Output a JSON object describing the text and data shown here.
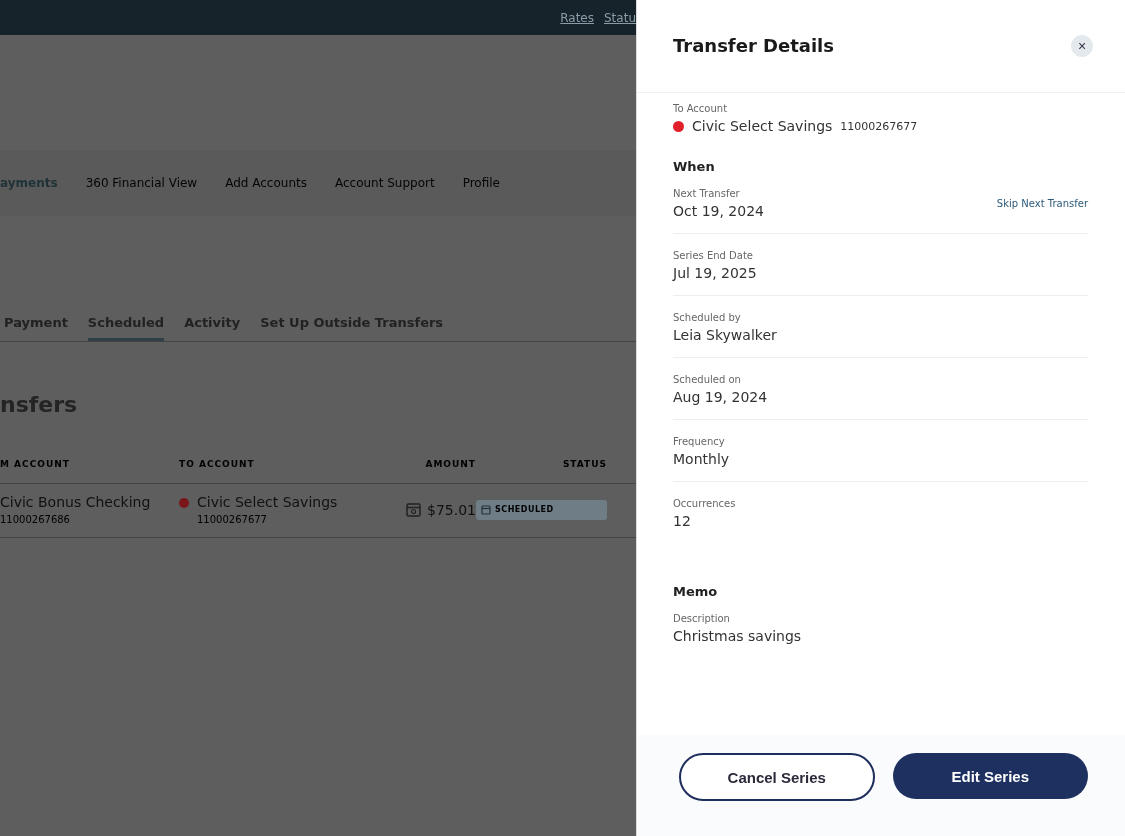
{
  "top_bar": {
    "links": [
      "Rates",
      "Statu"
    ]
  },
  "nav": {
    "items": [
      {
        "label": "ayments",
        "selected": true
      },
      {
        "label": "360 Financial View",
        "selected": false
      },
      {
        "label": "Add Accounts",
        "selected": false
      },
      {
        "label": "Account Support",
        "selected": false
      },
      {
        "label": "Profile",
        "selected": false
      }
    ]
  },
  "tabs": [
    {
      "label": "Payment",
      "selected": false
    },
    {
      "label": "Scheduled",
      "selected": true
    },
    {
      "label": "Activity",
      "selected": false
    },
    {
      "label": "Set Up Outside Transfers",
      "selected": false
    }
  ],
  "page_heading": "nsfers",
  "table": {
    "columns": [
      "M ACCOUNT",
      "TO ACCOUNT",
      "AMOUNT",
      "STATUS"
    ],
    "rows": [
      {
        "from_account": {
          "name": "Civic Bonus Checking",
          "number": "11000267686"
        },
        "to_account": {
          "name": "Civic Select Savings",
          "number": "11000267677",
          "color": "#7a1519"
        },
        "amount": "$75.01",
        "status": "SCHEDULED"
      }
    ]
  },
  "panel": {
    "title": "Transfer Details",
    "close": "×",
    "to_account": {
      "label": "To Account",
      "name": "Civic Select Savings",
      "number": "11000267677",
      "color": "#e0202a"
    },
    "sections": [
      {
        "heading": "When",
        "fields": [
          {
            "label": "Next Transfer",
            "value": "Oct 19, 2024",
            "action": "Skip Next Transfer"
          },
          {
            "label": "Series End Date",
            "value": "Jul 19, 2025"
          },
          {
            "label": "Scheduled by",
            "value": "Leia Skywalker"
          },
          {
            "label": "Scheduled on",
            "value": "Aug 19, 2024"
          },
          {
            "label": "Frequency",
            "value": "Monthly"
          },
          {
            "label": "Occurrences",
            "value": "12"
          }
        ]
      },
      {
        "heading": "Memo",
        "fields": [
          {
            "label": "Description",
            "value": "Christmas savings"
          }
        ]
      }
    ],
    "buttons": [
      {
        "label": "Cancel Series",
        "kind": "outline"
      },
      {
        "label": "Edit Series",
        "kind": "primary"
      }
    ]
  }
}
